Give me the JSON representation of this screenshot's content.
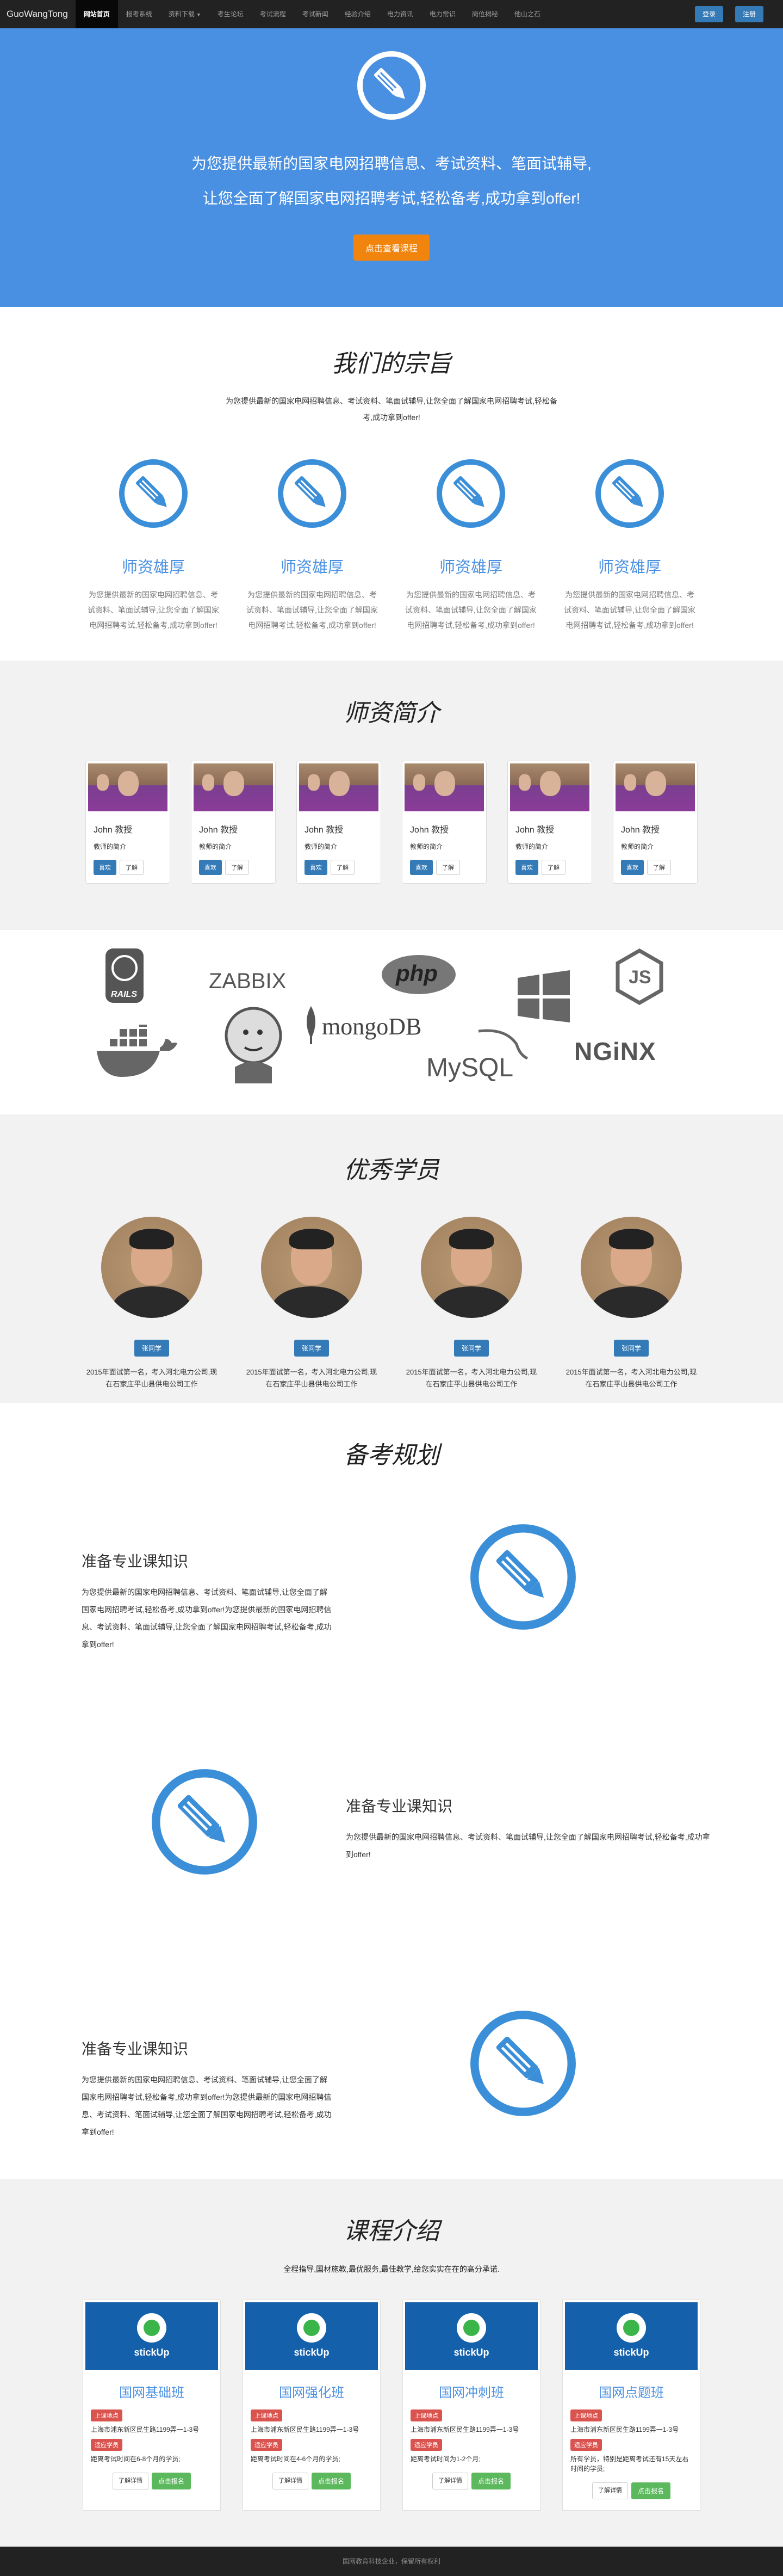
{
  "nav": {
    "brand": "GuoWangTong",
    "items": [
      {
        "label": "网站首页",
        "active": true
      },
      {
        "label": "报考系统",
        "active": false
      },
      {
        "label": "资料下载",
        "active": false,
        "dropdown": true
      },
      {
        "label": "考生论坛",
        "active": false
      },
      {
        "label": "考试流程",
        "active": false
      },
      {
        "label": "考试新闻",
        "active": false
      },
      {
        "label": "经验介绍",
        "active": false
      },
      {
        "label": "电力资讯",
        "active": false
      },
      {
        "label": "电力常识",
        "active": false
      },
      {
        "label": "岗位揭秘",
        "active": false
      },
      {
        "label": "他山之石",
        "active": false
      }
    ],
    "login": "登录",
    "register": "注册"
  },
  "hero": {
    "line1": "为您提供最新的国家电网招聘信息、考试资料、笔面试辅导,",
    "line2": "让您全面了解国家电网招聘考试,轻松备考,成功拿到offer!",
    "button": "点击查看课程"
  },
  "mission": {
    "title": "我们的宗旨",
    "intro": "为您提供最新的国家电网招聘信息、考试资料、笔面试辅导,让您全面了解国家电网招聘考试,轻松备考,成功拿到offer!",
    "columns": [
      {
        "title": "师资雄厚",
        "text": "为您提供最新的国家电网招聘信息、考试资料、笔面试辅导,让您全面了解国家电网招聘考试,轻松备考,成功拿到offer!"
      },
      {
        "title": "师资雄厚",
        "text": "为您提供最新的国家电网招聘信息、考试资料、笔面试辅导,让您全面了解国家电网招聘考试,轻松备考,成功拿到offer!"
      },
      {
        "title": "师资雄厚",
        "text": "为您提供最新的国家电网招聘信息、考试资料、笔面试辅导,让您全面了解国家电网招聘考试,轻松备考,成功拿到offer!"
      },
      {
        "title": "师资雄厚",
        "text": "为您提供最新的国家电网招聘信息、考试资料、笔面试辅导,让您全面了解国家电网招聘考试,轻松备考,成功拿到offer!"
      }
    ]
  },
  "teachers": {
    "title": "师资简介",
    "cards": [
      {
        "name": "John 教授",
        "sub": "教师的简介",
        "like": "喜欢",
        "more": "了解"
      },
      {
        "name": "John 教授",
        "sub": "教师的简介",
        "like": "喜欢",
        "more": "了解"
      },
      {
        "name": "John 教授",
        "sub": "教师的简介",
        "like": "喜欢",
        "more": "了解"
      },
      {
        "name": "John 教授",
        "sub": "教师的简介",
        "like": "喜欢",
        "more": "了解"
      },
      {
        "name": "John 教授",
        "sub": "教师的简介",
        "like": "喜欢",
        "more": "了解"
      },
      {
        "name": "John 教授",
        "sub": "教师的简介",
        "like": "喜欢",
        "more": "了解"
      }
    ]
  },
  "logos": {
    "rails": "RAILS",
    "zabbix": "ZABBIX",
    "php": "php",
    "node": "JS",
    "mongodb": "mongoDB",
    "mysql": "MySQL",
    "nginx": "NGiNX"
  },
  "students": {
    "title": "优秀学员",
    "items": [
      {
        "name": "张同学",
        "desc": "2015年面试第一名，考入河北电力公司,现在石家庄平山县供电公司工作"
      },
      {
        "name": "张同学",
        "desc": "2015年面试第一名，考入河北电力公司,现在石家庄平山县供电公司工作"
      },
      {
        "name": "张同学",
        "desc": "2015年面试第一名，考入河北电力公司,现在石家庄平山县供电公司工作"
      },
      {
        "name": "张同学",
        "desc": "2015年面试第一名，考入河北电力公司,现在石家庄平山县供电公司工作"
      }
    ]
  },
  "plan": {
    "title": "备考规划",
    "rows": [
      {
        "title": "准备专业课知识",
        "text": "为您提供最新的国家电网招聘信息、考试资料、笔面试辅导,让您全面了解国家电网招聘考试,轻松备考,成功拿到offer!为您提供最新的国家电网招聘信息、考试资料、笔面试辅导,让您全面了解国家电网招聘考试,轻松备考,成功拿到offer!"
      },
      {
        "title": "准备专业课知识",
        "text": "为您提供最新的国家电网招聘信息、考试资料、笔面试辅导,让您全面了解国家电网招聘考试,轻松备考,成功拿到offer!"
      },
      {
        "title": "准备专业课知识",
        "text": "为您提供最新的国家电网招聘信息、考试资料、笔面试辅导,让您全面了解国家电网招聘考试,轻松备考,成功拿到offer!为您提供最新的国家电网招聘信息、考试资料、笔面试辅导,让您全面了解国家电网招聘考试,轻松备考,成功拿到offer!"
      }
    ]
  },
  "courses": {
    "title": "课程介绍",
    "subtitle": "全程指导,国材施教,最优服务,最佳教学,给您实实在在的高分承诺.",
    "cards": [
      {
        "banner": "stickUp",
        "title": "国网基础班",
        "tag1": "上课地点",
        "addr": "上海市浦东新区民生路1199弄一1-3号",
        "tag2": "适应学员",
        "who": "距离考试时间在6-8个月的学员;",
        "detail": "了解详情",
        "signup": "点击报名"
      },
      {
        "banner": "stickUp",
        "title": "国网强化班",
        "tag1": "上课地点",
        "addr": "上海市浦东新区民生路1199弄一1-3号",
        "tag2": "适应学员",
        "who": "距离考试时间在4-6个月的学员;",
        "detail": "了解详情",
        "signup": "点击报名"
      },
      {
        "banner": "stickUp",
        "title": "国网冲刺班",
        "tag1": "上课地点",
        "addr": "上海市浦东新区民生路1199弄一1-3号",
        "tag2": "适应学员",
        "who": "距离考试时间为1-2个月;",
        "detail": "了解详情",
        "signup": "点击报名"
      },
      {
        "banner": "stickUp",
        "title": "国网点题班",
        "tag1": "上课地点",
        "addr": "上海市浦东新区民生路1199弄一1-3号",
        "tag2": "适应学员",
        "who": "所有学员，特别是距离考试还有15天左右时间的学员;",
        "detail": "了解详情",
        "signup": "点击报名"
      }
    ]
  },
  "footer": {
    "text": "国网教育科技企业，保留所有权利"
  }
}
